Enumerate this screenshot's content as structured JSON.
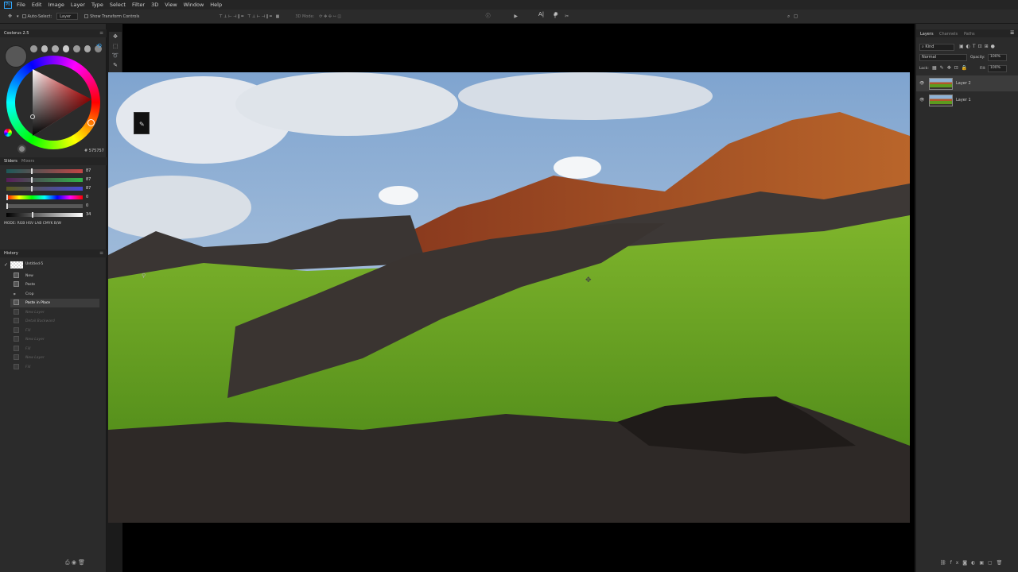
{
  "menu": {
    "logo": "Ps",
    "items": [
      "File",
      "Edit",
      "Image",
      "Layer",
      "Type",
      "Select",
      "Filter",
      "3D",
      "View",
      "Window",
      "Help"
    ]
  },
  "options": {
    "auto_select": "Auto-Select:",
    "layer_select": "Layer",
    "show_transform": "Show Transform Controls",
    "mode_3d": "3D Mode:"
  },
  "coolorus": {
    "title": "Coolorus 2.5",
    "hex": "575757"
  },
  "sliders": {
    "tabs": [
      "Sliders",
      "Mixers"
    ],
    "values": [
      "87",
      "87",
      "87",
      "0",
      "0",
      "34"
    ],
    "modes": "MODE: RGB HSV LAB CMYK B/W"
  },
  "history": {
    "title": "History",
    "snapshot": "Untitled-5",
    "items": [
      "New",
      "Paste",
      "Crop",
      "Paste in Place",
      "New Layer",
      "Detail Backward",
      "Fill",
      "New Layer",
      "Fill",
      "New Layer",
      "Fill"
    ]
  },
  "layers": {
    "tabs": [
      "Layers",
      "Channels",
      "Paths"
    ],
    "kind": "Kind",
    "blend": "Normal",
    "opacity_label": "Opacity:",
    "opacity": "100%",
    "lock_label": "Lock:",
    "fill_label": "Fill:",
    "fill": "100%",
    "rows": [
      "Layer 2",
      "Layer 1"
    ]
  },
  "colors": {
    "accent": "#31a8ff",
    "selected_row": "#3c3c3c"
  }
}
